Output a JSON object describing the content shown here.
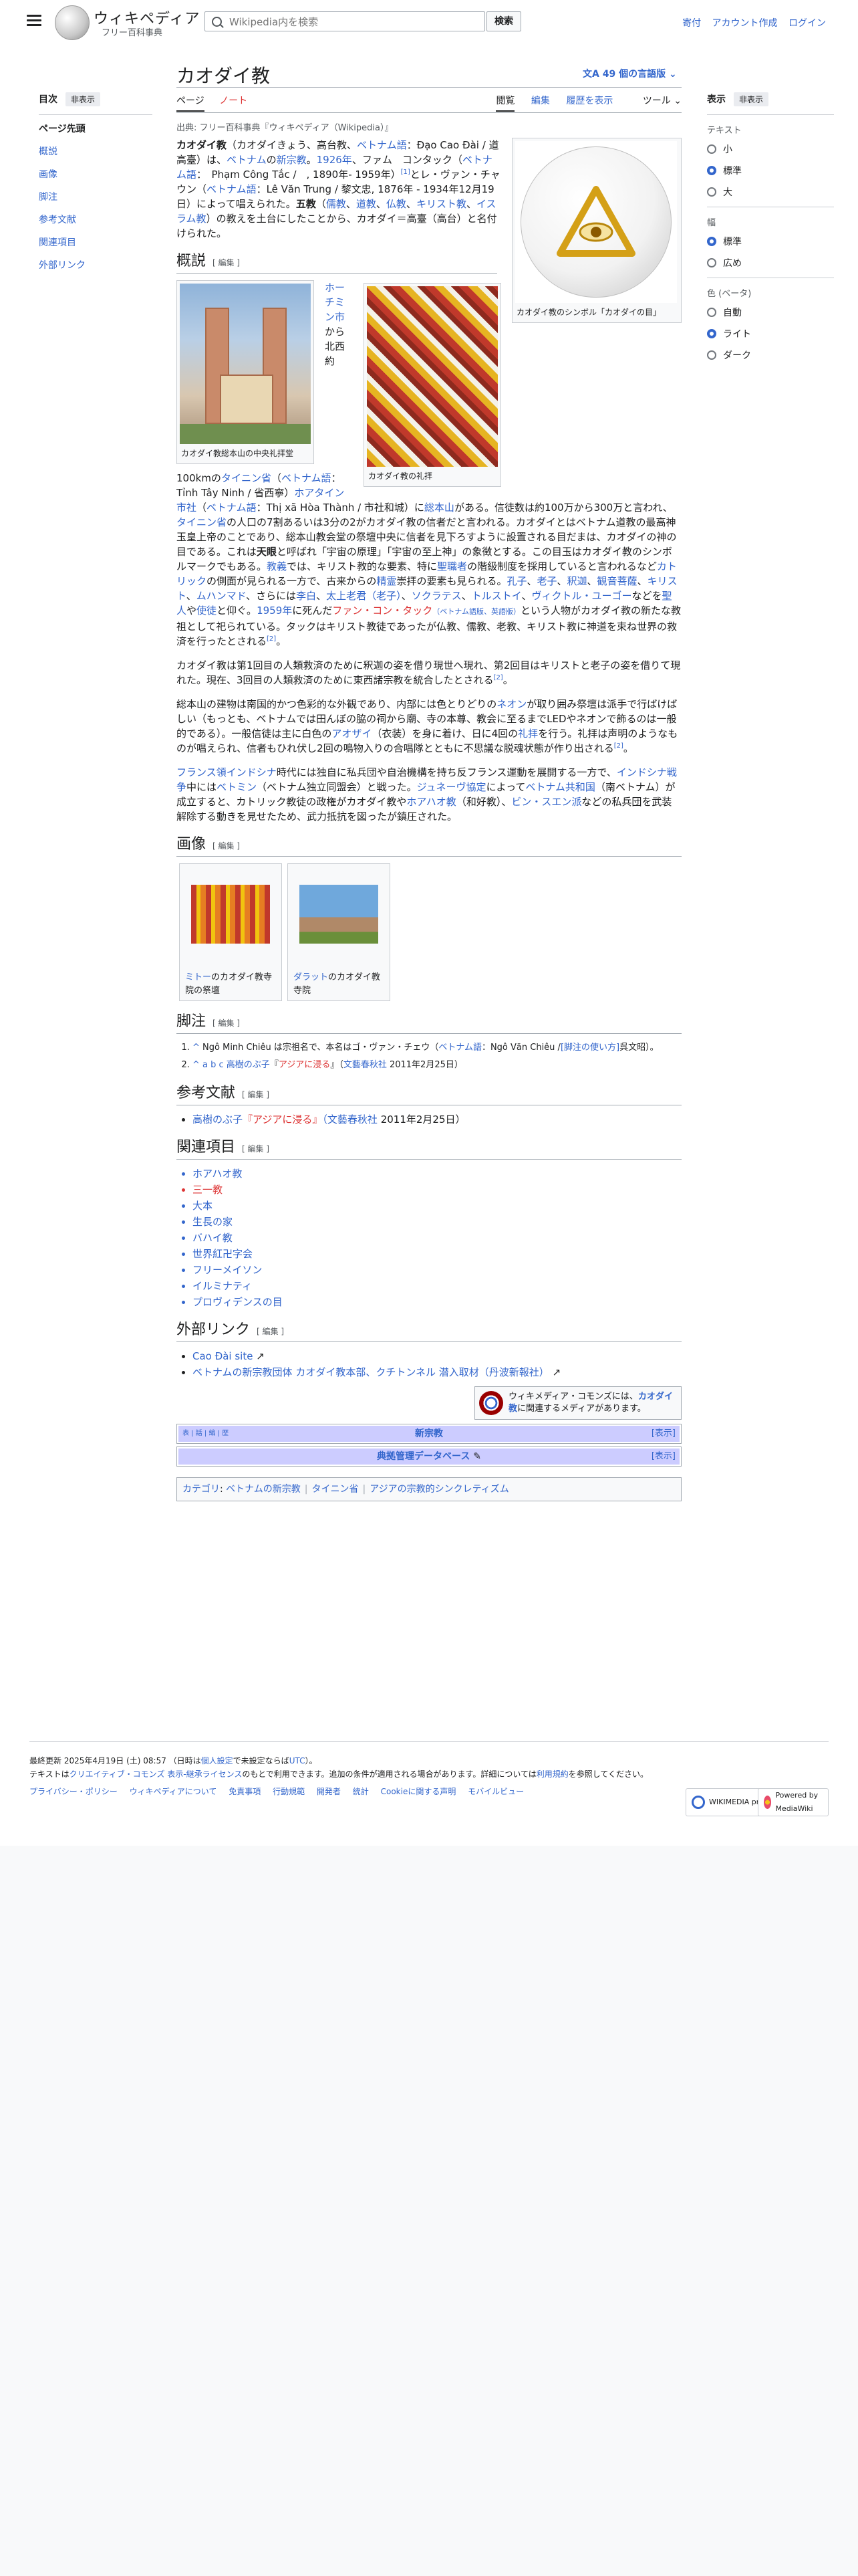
{
  "header": {
    "wordmark": "ウィキペディア",
    "tagline": "フリー百科事典",
    "search_placeholder": "Wikipedia内を検索",
    "search_button": "検索",
    "user_links": [
      "寄付",
      "アカウント作成",
      "ログイン"
    ]
  },
  "toc": {
    "title": "目次",
    "hide": "非表示",
    "top": "ページ先頭",
    "items": [
      "概説",
      "画像",
      "脚注",
      "参考文献",
      "関連項目",
      "外部リンク"
    ]
  },
  "appearance": {
    "title": "表示",
    "hide": "非表示",
    "text_label": "テキスト",
    "text_options": [
      "小",
      "標準",
      "大"
    ],
    "width_label": "幅",
    "width_options": [
      "標準",
      "広め"
    ],
    "color_label": "色 (ベータ)",
    "color_options": [
      "自動",
      "ライト",
      "ダーク"
    ]
  },
  "article": {
    "title": "カオダイ教",
    "languages": "49 個の言語版",
    "tabs_left": [
      "ページ",
      "ノート"
    ],
    "tabs_right": [
      "閲覧",
      "編集",
      "履歴を表示",
      "ツール"
    ],
    "from": "出典: フリー百科事典『ウィキペディア（Wikipedia）』",
    "edit_label": "[ 編集 ]",
    "symbol_caption": "カオダイ教のシンボル「カオダイの目」",
    "temple_caption": "カオダイ教総本山の中央礼拝堂",
    "festival_caption": "カオダイ教の礼拝",
    "intro": {
      "t1": "カオダイ教",
      "t2": "（カオダイきょう、高台教、",
      "t3": "ベトナム語",
      "t4": "：Đạo Cao Đài / 道高臺）は、",
      "t5": "ベトナム",
      "t6": "の",
      "t7": "新宗教",
      "t8": "。",
      "t9": "1926年",
      "t10": "、ファム　コンタック（",
      "t11": "ベトナム語",
      "t12": "：　Phạm Công Tắc /　, 1890年- 1959年）",
      "t13": "[1]",
      "t14": "とレ・ヴァン・チャウン（",
      "t15": "ベトナム語",
      "t16": "：Lê Văn Trung / 黎文忠, 1876年 - 1934年12月19日）によって唱えられた。",
      "t17": "五教",
      "t18": "（",
      "t19": "儒教",
      "t20": "、",
      "t21": "道教",
      "t22": "、",
      "t23": "仏教",
      "t24": "、",
      "t25": "キリスト教",
      "t26": "、",
      "t27": "イスラム教",
      "t28": "）の教えを土台にしたことから、カオダイ＝高臺（高台）と名付けられた。"
    },
    "h_overview": "概説",
    "ov1": {
      "a1": "ホーチミン市",
      "a2": "から北西約100kmの",
      "a3": "タイニン省",
      "a4": "（",
      "a5": "ベトナム語",
      "a6": "：Tỉnh Tây Ninh / 省西寧）",
      "a7": "ホアタイン市社",
      "a8": "（",
      "a9": "ベトナム語",
      "a10": "：Thị xã Hòa Thành / 市社和城）に",
      "a11": "総本山",
      "a12": "がある。信徒数は約100万から300万と言われ、",
      "a13": "タイニン省",
      "a14": "の人口の7割あるいは3分の2がカオダイ教の信者だと言われる。カオダイとはベトナム道教の最高神玉皇上帝のことであり、総本山教会堂の祭壇中央に信者を見下ろすように設置される目だまは、カオダイの神の目である。これは",
      "a15": "天眼",
      "a16": "と呼ばれ「宇宙の原理」「宇宙の至上神」の象徴とする。この目玉はカオダイ教のシンボルマークでもある。",
      "a17": "教義",
      "a18": "では、キリスト教的な要素、特に",
      "a19": "聖職者",
      "a20": "の階級制度を採用していると言われるなど",
      "a21": "カトリック",
      "a22": "の側面が見られる一方で、古来からの",
      "a23": "精霊",
      "a24": "崇拝の要素も見られる。",
      "a25": "孔子",
      "a26": "、",
      "a27": "老子",
      "a28": "、",
      "a29": "釈迦",
      "a30": "、",
      "a31": "観音菩薩",
      "a32": "、",
      "a33": "キリスト",
      "a34": "、",
      "a35": "ムハンマド",
      "a36": "、さらには",
      "a37": "李白",
      "a38": "、",
      "a39": "太上老君（老子）",
      "a40": "、",
      "a41": "ソクラテス",
      "a42": "、",
      "a43": "トルストイ",
      "a44": "、",
      "a45": "ヴィクトル・ユーゴー",
      "a46": "などを",
      "a47": "聖人",
      "a48": "や",
      "a49": "使徒",
      "a50": "と仰ぐ。",
      "a51": "1959年",
      "a52": "に死んだ",
      "a53": "ファン・コン・タック",
      "a54": "（ベトナム語版、英語版）",
      "a55": "という人物がカオダイ教の新たな教祖として祀られている。タックはキリスト教徒であったが仏教、儒教、老教、キリスト教に神道を束ね世界の救済を行ったとされる",
      "a56": "[2]",
      "a57": "。"
    },
    "ov2": {
      "b1": "カオダイ教は第1回目の人類救済のために釈迦の姿を借り現世へ現れ、第2回目はキリストと老子の姿を借りて現れた。現在、3回目の人類救済のために東西諸宗教を統合したとされる",
      "b2": "[2]",
      "b3": "。"
    },
    "ov3": {
      "c1": "総本山の建物は南国的かつ色彩的な外観であり、内部には色とりどりの",
      "c2": "ネオン",
      "c3": "が取り囲み祭壇は派手で行ばけばしい（もっとも、ベトナムでは田んぼの脇の祠から廟、寺の本尊、教会に至るまでLEDやネオンで飾るのは一般的である）。一般信徒は主に白色の",
      "c4": "アオザイ",
      "c5": "（衣装）を身に着け、日に4回の",
      "c6": "礼拝",
      "c7": "を行う。礼拝は声明のようなものが唱えられ、信者もひれ伏し2回の鳴物入りの合唱隊とともに不思議な脱魂状態が作り出される",
      "c8": "[2]",
      "c9": "。"
    },
    "ov4": {
      "d1": "フランス領インドシナ",
      "d2": "時代には独自に私兵団や自治機構を持ち反フランス運動を展開する一方で、",
      "d3": "インドシナ戦争",
      "d4": "中には",
      "d5": "ベトミン",
      "d6": "（ベトナム独立同盟会）と戦った。",
      "d7": "ジュネーヴ協定",
      "d8": "によって",
      "d9": "ベトナム共和国",
      "d10": "（南ベトナム）が成立すると、カトリック教徒の政権がカオダイ教や",
      "d11": "ホアハオ教",
      "d12": "（和好教）、",
      "d13": "ビン・スエン派",
      "d14": "などの私兵団を武装解除する動きを見せたため、武力抵抗を図ったが鎮圧された。"
    },
    "h_images": "画像",
    "gallery": [
      {
        "link": "ミトー",
        "text": "のカオダイ教寺院の祭壇"
      },
      {
        "link": "ダラット",
        "text": "のカオダイ教寺院"
      }
    ],
    "h_notes": "脚注",
    "notes": [
      {
        "mark": "^",
        "pre": " Ngô Minh Chiêu は宗祖名で、本名はゴ・ヴァン・チェウ（",
        "link1": "ベトナム語",
        "mid": "：Ngô Văn Chiêu /",
        "link2": "[脚注の使い方]",
        "post": "呉文昭）。"
      },
      {
        "mark": "^ a b c",
        "link1": "高樹のぶ子",
        "mid": "『",
        "link2": "アジアに浸る",
        "mid2": "』（",
        "link3": "文藝春秋社",
        "post": " 2011年2月25日）"
      }
    ],
    "h_refs": "参考文献",
    "refs": [
      {
        "link1": "高樹のぶ子",
        "link2": "『アジアに浸る』",
        "link3": "（文藝春秋社",
        "post": " 2011年2月25日）"
      }
    ],
    "h_related": "関連項目",
    "related": [
      "ホアハオ教",
      "三一教",
      "大本",
      "生長の家",
      "バハイ教",
      "世界紅卍字会",
      "フリーメイソン",
      "イルミナティ",
      "プロヴィデンスの目"
    ],
    "h_external": "外部リンク",
    "external": [
      "Cao Đài site",
      "ベトナムの新宗教団体 カオダイ教本部、クチトンネル 潜入取材（丹波新報社）"
    ],
    "commons_pre": "ウィキメディア・コモンズには、",
    "commons_link": "カオダイ教",
    "commons_post": "に関連するメディアがあります。",
    "navbox1": {
      "vde": "表 | 話 | 編 | 歴",
      "title": "新宗教",
      "show": "[表示]"
    },
    "navbox2": {
      "title": "典拠管理データベース",
      "show": "[表示]"
    },
    "cats_label": "カテゴリ",
    "cats": [
      "ベトナムの新宗教",
      "タイニン省",
      "アジアの宗教的シンクレティズム"
    ]
  },
  "footer": {
    "updated": "最終更新 2025年4月19日 (土) 08:57 （日時は",
    "updated_link": "個人設定",
    "updated_post": "で未設定ならば",
    "utc": "UTC",
    "updated_end": "）。",
    "license_pre": "テキストは",
    "license_link": "クリエイティブ・コモンズ 表示-継承ライセンス",
    "license_post": "のもとで利用できます。追加の条件が適用される場合があります。詳細については",
    "terms_link": "利用規約",
    "license_end": "を参照してください。",
    "links": [
      "プライバシー・ポリシー",
      "ウィキペディアについて",
      "免責事項",
      "行動規範",
      "開発者",
      "統計",
      "Cookieに関する声明",
      "モバイルビュー"
    ],
    "badge1": "WIKIMEDIA project",
    "badge2": "Powered by MediaWiki"
  }
}
